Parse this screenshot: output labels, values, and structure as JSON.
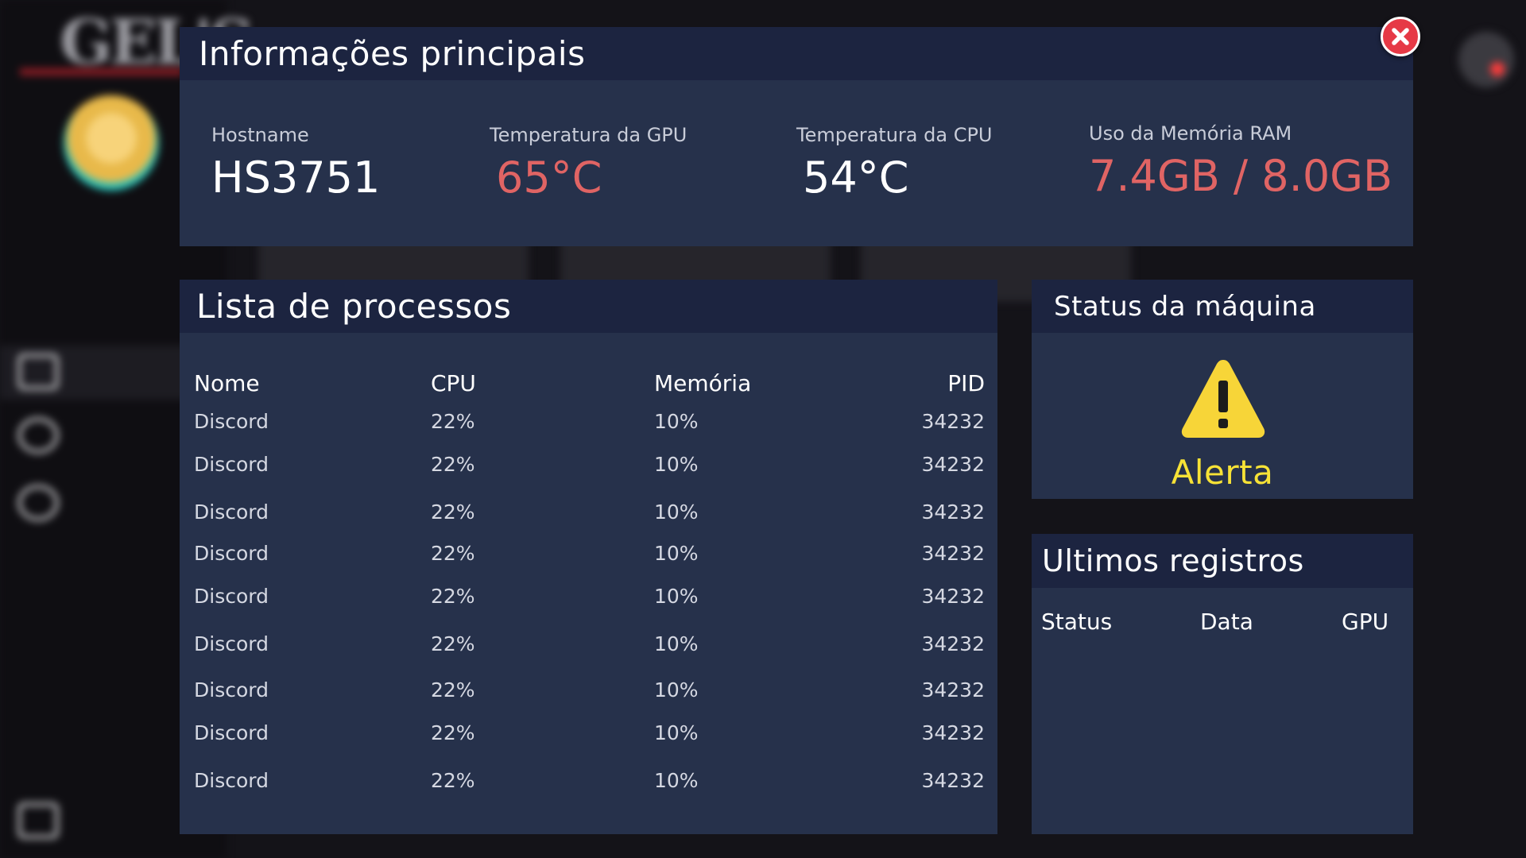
{
  "main_info": {
    "title": "Informações principais",
    "hostname_label": "Hostname",
    "hostname": "HS3751",
    "gpu_temp_label": "Temperatura da GPU",
    "gpu_temp": "65°C",
    "cpu_temp_label": "Temperatura da CPU",
    "cpu_temp": "54°C",
    "ram_label": "Uso da Memória RAM",
    "ram_usage": "7.4GB / 8.0GB"
  },
  "processes": {
    "title": "Lista de processos",
    "columns": {
      "name": "Nome",
      "cpu": "CPU",
      "memory": "Memória",
      "pid": "PID"
    },
    "rows": [
      {
        "name": "Discord",
        "cpu": "22%",
        "memory": "10%",
        "pid": "34232"
      },
      {
        "name": "Discord",
        "cpu": "22%",
        "memory": "10%",
        "pid": "34232"
      },
      {
        "name": "Discord",
        "cpu": "22%",
        "memory": "10%",
        "pid": "34232"
      },
      {
        "name": "Discord",
        "cpu": "22%",
        "memory": "10%",
        "pid": "34232"
      },
      {
        "name": "Discord",
        "cpu": "22%",
        "memory": "10%",
        "pid": "34232"
      },
      {
        "name": "Discord",
        "cpu": "22%",
        "memory": "10%",
        "pid": "34232"
      },
      {
        "name": "Discord",
        "cpu": "22%",
        "memory": "10%",
        "pid": "34232"
      },
      {
        "name": "Discord",
        "cpu": "22%",
        "memory": "10%",
        "pid": "34232"
      },
      {
        "name": "Discord",
        "cpu": "22%",
        "memory": "10%",
        "pid": "34232"
      }
    ]
  },
  "machine_status": {
    "title": "Status da máquina",
    "status": "Alerta",
    "icon": "warning-icon",
    "status_color": "#f7e236"
  },
  "logs": {
    "title": "Ultimos registros",
    "columns": {
      "status": "Status",
      "date": "Data",
      "gpu": "GPU"
    }
  },
  "colors": {
    "panel": "#26314b",
    "panel_header": "#1c2440",
    "hot_value": "#e06464",
    "close_button": "#e63946"
  }
}
